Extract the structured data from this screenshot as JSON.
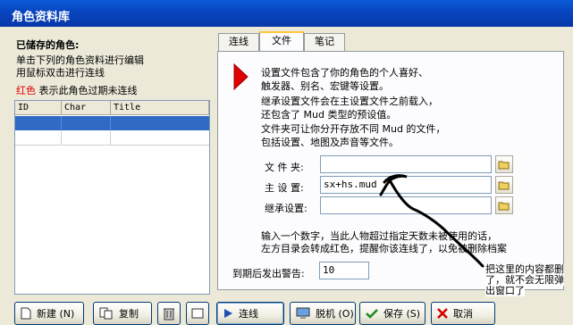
{
  "window": {
    "title": "角色资料库"
  },
  "left": {
    "heading": "已储存的角色:",
    "line1": "单击下列的角色资料进行编辑",
    "line2": "用鼠标双击进行连线",
    "red_word": "红色",
    "red_rest": " 表示此角色过期未连线",
    "columns": [
      "ID",
      "Char",
      "Title"
    ]
  },
  "tabs": [
    "连线",
    "文件",
    "笔记"
  ],
  "file_tab": {
    "desc": [
      "设置文件包含了你的角色的个人喜好、",
      "触发器、别名、宏键等设置。",
      "继承设置文件会在主设置文件之前载入，",
      "还包含了 Mud 类型的预设值。",
      "文件夹可让你分开存放不同 Mud 的文件，",
      "包括设置、地图及声音等文件。"
    ],
    "folder_label": "文 件 夹:",
    "folder_value": "",
    "main_label": "主 设 置:",
    "main_value": "sx+hs.mud",
    "inherit_label": "继承设置:",
    "inherit_value": "",
    "note1": "输入一个数字，当此人物超过指定天数未被使用的话，",
    "note2": "左方目录会转成红色，提醒你该连线了，以免被删除档案",
    "warn_label": "到期后发出警告:",
    "warn_value": "10"
  },
  "annotation": {
    "line1": "把这里的内容都删",
    "line2": "了，就不会无限弹",
    "line3": "出窗口了"
  },
  "buttons": {
    "new": "新建 (N)",
    "copy": "复制",
    "connect": "连线",
    "offline": "脱机 (O)",
    "save": "保存 (S)",
    "cancel": "取消"
  }
}
